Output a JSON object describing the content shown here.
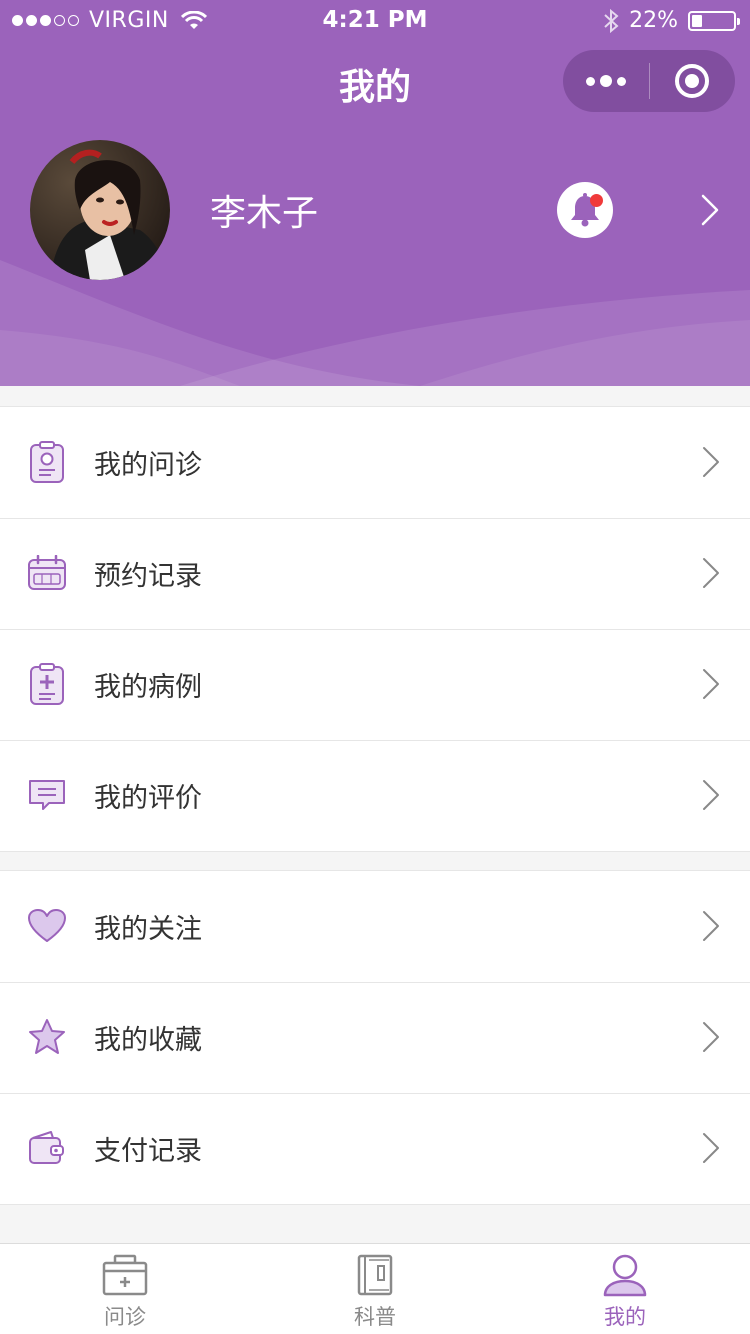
{
  "status_bar": {
    "carrier": "VIRGIN",
    "time": "4:21 PM",
    "battery": "22%",
    "battery_level": 0.22
  },
  "nav": {
    "title": "我的"
  },
  "profile": {
    "name": "李木子",
    "has_notification": true
  },
  "menu_groups": [
    [
      {
        "label": "我的问诊",
        "icon": "clipboard-id-icon"
      },
      {
        "label": "预约记录",
        "icon": "calendar-icon"
      },
      {
        "label": "我的病例",
        "icon": "medical-record-icon"
      },
      {
        "label": "我的评价",
        "icon": "comment-icon"
      }
    ],
    [
      {
        "label": "我的关注",
        "icon": "heart-icon"
      },
      {
        "label": "我的收藏",
        "icon": "star-icon"
      },
      {
        "label": "支付记录",
        "icon": "wallet-icon"
      }
    ]
  ],
  "tabbar": [
    {
      "label": "问诊",
      "icon": "medical-kit-icon",
      "active": false
    },
    {
      "label": "科普",
      "icon": "book-icon",
      "active": false
    },
    {
      "label": "我的",
      "icon": "user-icon",
      "active": true
    }
  ],
  "colors": {
    "primary": "#9b63bb",
    "text": "#333333",
    "muted": "#8a8a8a",
    "notification": "#f03a3a"
  }
}
